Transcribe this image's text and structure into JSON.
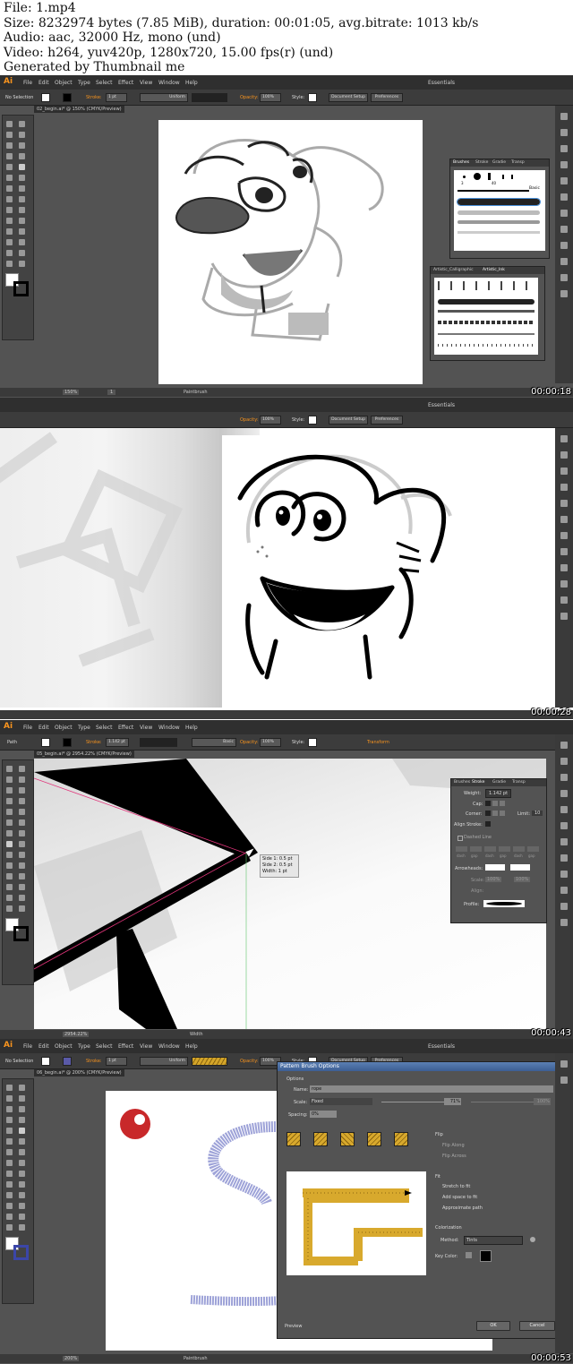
{
  "header": {
    "file": "File: 1.mp4",
    "size": "Size: 8232974 bytes (7.85 MiB), duration: 00:01:05, avg.bitrate: 1013 kb/s",
    "audio": "Audio: aac, 32000 Hz, mono (und)",
    "video": "Video: h264, yuv420p, 1280x720, 15.00 fps(r) (und)",
    "generated": "Generated by Thumbnail me"
  },
  "app": {
    "logo": "Ai",
    "menu": [
      "File",
      "Edit",
      "Object",
      "Type",
      "Select",
      "Effect",
      "View",
      "Window",
      "Help"
    ],
    "workspace": "Essentials"
  },
  "frames": [
    {
      "timestamp": "00:00:18",
      "selection": "No Selection",
      "stroke_label": "Stroke:",
      "stroke_value": "1 pt",
      "stroke_style": "Uniform",
      "opacity_label": "Opacity:",
      "opacity_value": "100%",
      "style_label": "Style:",
      "doc_setup": "Document Setup",
      "preferences": "Preferences",
      "doc_tab": "02_begin.ai* @ 150% (CMYK/Preview)",
      "zoom": "150%",
      "page": "1",
      "status_tool": "Paintbrush",
      "brushes_panel": {
        "tabs": [
          "Brushes",
          "Stroke",
          "Gradie",
          "Transp"
        ],
        "sizes": [
          "3",
          "40"
        ],
        "basic_label": "Basic"
      },
      "artistic_panel": {
        "tabs": [
          "Artistic_Calligraphic",
          "Artistic_Ink"
        ]
      }
    },
    {
      "timestamp": "00:00:28",
      "opacity_label": "Opacity:",
      "opacity_value": "100%",
      "style_label": "Style:",
      "doc_setup": "Document Setup",
      "preferences": "Preferences",
      "workspace": "Essentials"
    },
    {
      "timestamp": "00:00:43",
      "selection": "Path",
      "stroke_label": "Stroke:",
      "stroke_value": "1.142 pt",
      "basic_label": "Basic",
      "opacity_label": "Opacity:",
      "opacity_value": "100%",
      "style_label": "Style:",
      "transform": "Transform",
      "doc_tab": "05_begin.ai* @ 2954.22% (CMYK/Preview)",
      "zoom": "2954.22%",
      "status_tool": "Width",
      "width_tip": [
        "Side 1: 0.5 pt",
        "Side 2: 0.5 pt",
        "Width: 1 pt"
      ],
      "stroke_panel": {
        "tabs": [
          "Brushes",
          "Stroke",
          "Gradie",
          "Transp"
        ],
        "weight_label": "Weight:",
        "weight_value": "1.142 pt",
        "cap_label": "Cap:",
        "corner_label": "Corner:",
        "limit_label": "Limit:",
        "limit_value": "10",
        "align_label": "Align Stroke:",
        "dashed_label": "Dashed Line",
        "dash_labels": [
          "dash",
          "gap",
          "dash",
          "gap",
          "dash",
          "gap"
        ],
        "arrowheads_label": "Arrowheads:",
        "scale_label": "Scale:",
        "scale_1": "100%",
        "scale_2": "100%",
        "align_label2": "Align:",
        "profile_label": "Profile:"
      }
    },
    {
      "timestamp": "00:00:53",
      "selection": "No Selection",
      "stroke_label": "Stroke:",
      "stroke_value": "1 pt",
      "stroke_style": "Uniform",
      "opacity_label": "Opacity:",
      "opacity_value": "100%",
      "style_label": "Style:",
      "doc_setup": "Document Setup",
      "preferences": "Preferences",
      "doc_tab": "06_begin.ai* @ 200% (CMYK/Preview)",
      "zoom": "200%",
      "status_tool": "Paintbrush",
      "dialog": {
        "title": "Pattern Brush Options",
        "options_label": "Options",
        "name_label": "Name:",
        "name_value": "rope",
        "scale_label": "Scale:",
        "scale_mode": "Fixed",
        "scale_value": "71%",
        "scale_value2": "100%",
        "spacing_label": "Spacing:",
        "spacing_value": "0%",
        "flip_label": "Flip",
        "flip_along": "Flip Along",
        "flip_across": "Flip Across",
        "fit_label": "Fit",
        "fit_stretch": "Stretch to fit",
        "fit_add": "Add space to fit",
        "fit_approx": "Approximate path",
        "colorization_label": "Colorization",
        "method_label": "Method:",
        "method_value": "Tints",
        "keycolor_label": "Key Color:",
        "preview_label": "Preview",
        "ok": "OK",
        "cancel": "Cancel"
      }
    }
  ]
}
